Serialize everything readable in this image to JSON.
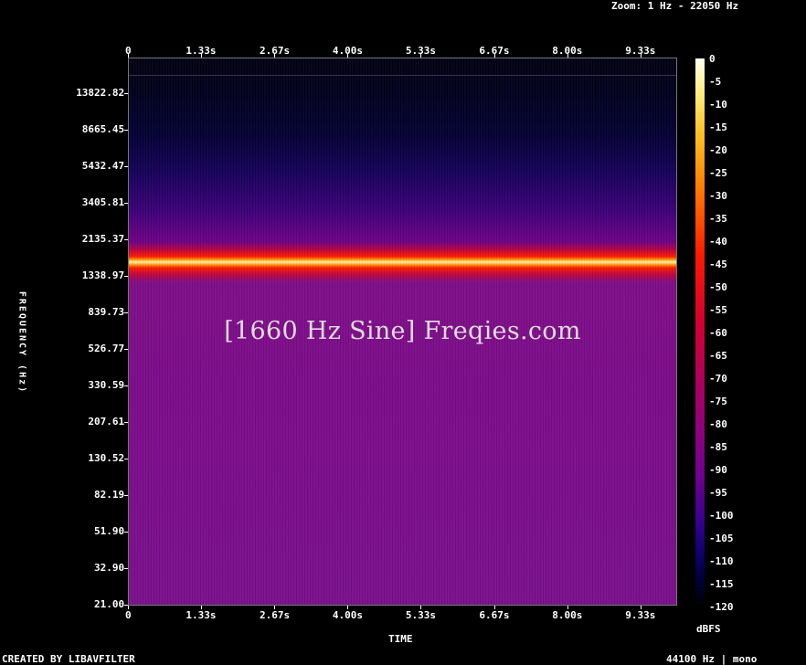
{
  "header": {
    "zoom": "Zoom: 1 Hz - 22050 Hz"
  },
  "footer": {
    "left": "CREATED BY LIBAVFILTER",
    "right": "44100 Hz | mono"
  },
  "watermark": "[1660 Hz Sine] Freqies.com",
  "chart_data": {
    "type": "heatmap",
    "title": "",
    "xlabel": "TIME",
    "ylabel": "FREQUENCY (Hz)",
    "x_ticks": [
      "0",
      "1.33s",
      "2.67s",
      "4.00s",
      "5.33s",
      "6.67s",
      "8.00s",
      "9.33s"
    ],
    "x_tick_seconds": [
      0,
      1.33,
      2.67,
      4.0,
      5.33,
      6.67,
      8.0,
      9.33
    ],
    "x_range_seconds": [
      0,
      10
    ],
    "y_ticks": [
      "13822.82",
      "8665.45",
      "5432.47",
      "3405.81",
      "2135.37",
      "1338.97",
      "839.73",
      "526.77",
      "330.59",
      "207.61",
      "130.52",
      "82.19",
      "51.90",
      "32.90",
      "21.00"
    ],
    "y_scale": "log",
    "y_range_hz": [
      21,
      22050
    ],
    "colorbar": {
      "label": "dBFS",
      "ticks": [
        "0",
        "-5",
        "-10",
        "-15",
        "-20",
        "-25",
        "-30",
        "-35",
        "-40",
        "-45",
        "-50",
        "-55",
        "-60",
        "-65",
        "-70",
        "-75",
        "-80",
        "-85",
        "-90",
        "-95",
        "-100",
        "-105",
        "-110",
        "-115",
        "-120"
      ],
      "range": [
        0,
        -120
      ]
    },
    "signal": {
      "frequency_hz": 1660,
      "level_dbfs": 0
    },
    "background_level_dbfs": -85
  },
  "colors": {
    "background": "#000000",
    "peak": "#fffde0",
    "band": "#ff2000",
    "floor": "#7a0f8c",
    "high_freq": "#000018"
  }
}
